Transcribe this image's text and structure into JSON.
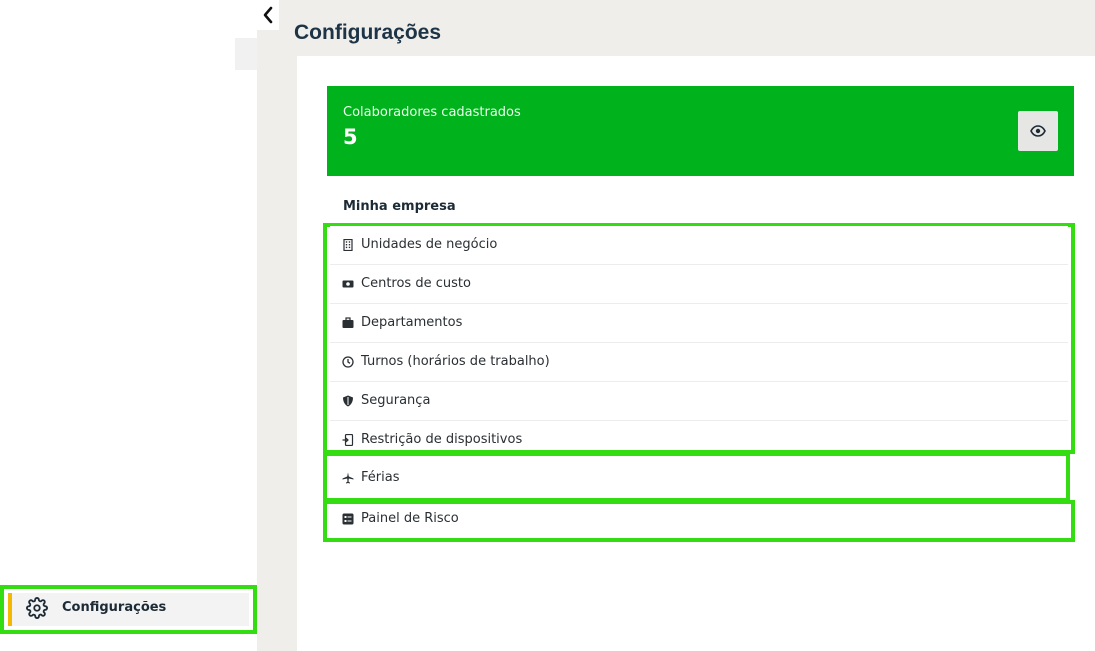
{
  "sidebar": {
    "active_item": {
      "label": "Configurações",
      "icon": "gear-icon"
    }
  },
  "header": {
    "title": "Configurações"
  },
  "summary": {
    "label": "Colaboradores cadastrados",
    "count": "5",
    "accent": "#00b21b"
  },
  "section": {
    "title": "Minha empresa",
    "items": [
      {
        "label": "Unidades de negócio",
        "icon": "building-icon"
      },
      {
        "label": "Centros de custo",
        "icon": "money-icon"
      },
      {
        "label": "Departamentos",
        "icon": "briefcase-icon"
      },
      {
        "label": "Turnos (horários de trabalho)",
        "icon": "clock-icon"
      },
      {
        "label": "Segurança",
        "icon": "shield-icon"
      },
      {
        "label": "Restrição de dispositivos",
        "icon": "device-lock-icon"
      },
      {
        "label": "Férias",
        "icon": "airplane-icon"
      },
      {
        "label": "Painel de Risco",
        "icon": "dashboard-icon"
      }
    ]
  },
  "highlight_color": "#33dd11"
}
